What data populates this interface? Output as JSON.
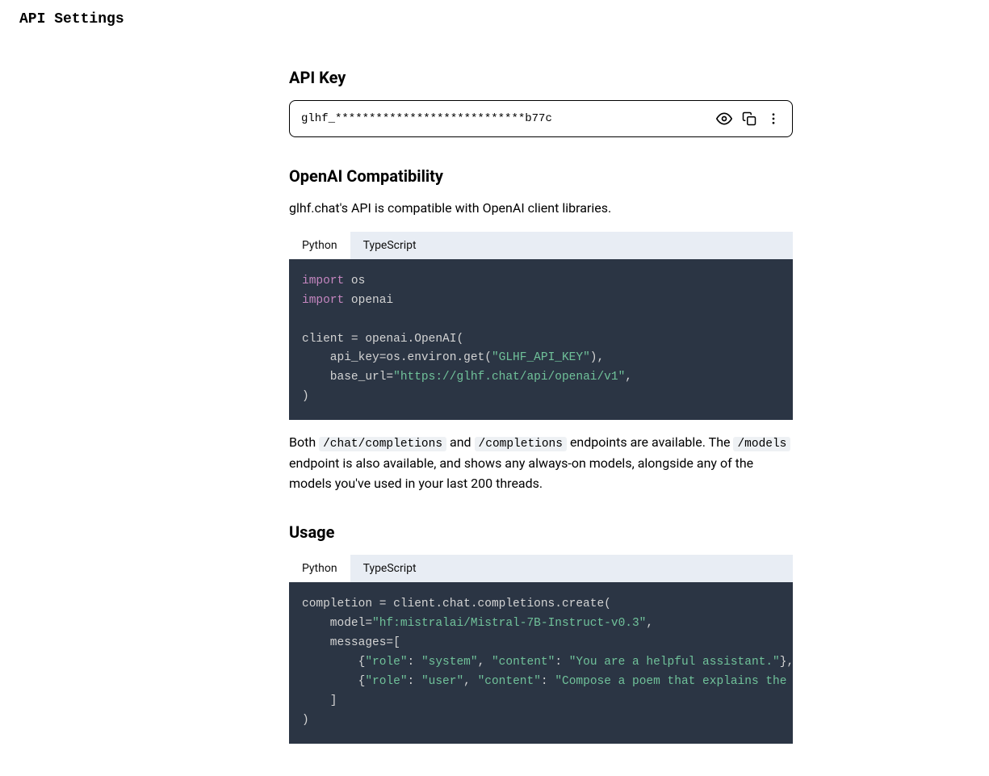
{
  "pageTitle": "API Settings",
  "sections": {
    "apiKey": {
      "title": "API Key",
      "value": "glhf_****************************b77c"
    },
    "openai": {
      "title": "OpenAI Compatibility",
      "desc": "glhf.chat's API is compatible with OpenAI client libraries."
    },
    "tabs": {
      "python": "Python",
      "typescript": "TypeScript"
    },
    "endpointsText": {
      "both": "Both ",
      "chatCompletions": "/chat/completions",
      "and": " and ",
      "completions": "/completions",
      "avail": " endpoints are available. The ",
      "models": "/models",
      "rest": " endpoint is also available, and shows any always-on models, alongside any of the models you've used in your last 200 threads."
    },
    "usage": {
      "title": "Usage"
    },
    "code1": {
      "import": "import",
      "os": " os",
      "openai": " openai",
      "client": "client ",
      "eq": "=",
      "openaiCall": " openai.OpenAI(",
      "apikeyParam": "    api_key",
      "osEnvGet": "os.environ.get(",
      "glhfKey": "\"GLHF_API_KEY\"",
      "closeComma": "),",
      "baseUrlParam": "    base_url",
      "baseUrlVal": "\"https://glhf.chat/api/openai/v1\"",
      "comma": ",",
      "closeParen": ")"
    },
    "code2": {
      "completion": "completion ",
      "eq": "=",
      "clientCall": " client.chat.completions.create(",
      "modelParam": "    model",
      "modelVal": "\"hf:mistralai/Mistral-7B-Instruct-v0.3\"",
      "comma": ",",
      "messagesParam": "    messages",
      "openBracket": "[",
      "roleKey": "\"role\"",
      "systemVal": "\"system\"",
      "contentKey": "\"content\"",
      "sysContent": "\"You are a helpful assistant.\"",
      "userVal": "\"user\"",
      "userContent": "\"Compose a poem that explains the con",
      "indent": "        ",
      "openBrace": "{",
      "closeBraceComma": "},",
      "colon": ": ",
      "commaSp": ", ",
      "closeBracket": "    ]",
      "closeParen": ")"
    }
  }
}
